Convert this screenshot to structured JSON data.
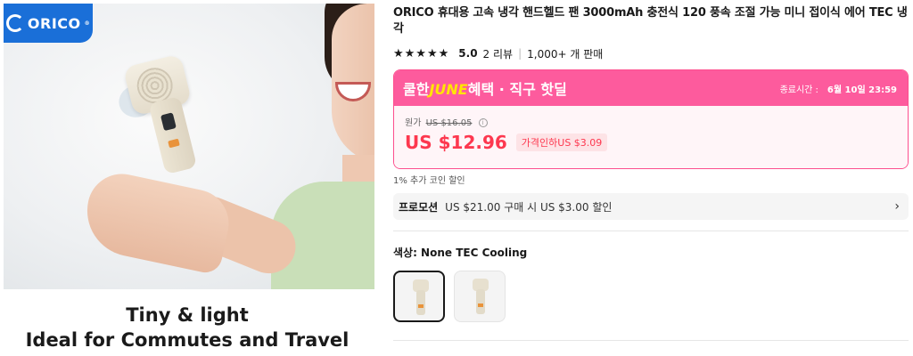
{
  "hero": {
    "brand_logo_text": "ORICO",
    "tagline_line1": "Tiny & light",
    "tagline_line2": "Ideal for Commutes and Travel"
  },
  "product": {
    "title": "ORICO 휴대용 고속 냉각 핸드헬드 팬 3000mAh 충전식 120 풍속 조절 가능 미니 접이식 에어 TEC 냉각",
    "rating_stars": "★★★★★",
    "rating_score": "5.0",
    "reviews": "2 리뷰",
    "sales": "1,000+ 개 판매"
  },
  "deal": {
    "name_prefix": "쿨한",
    "name_highlight": "JUNE",
    "name_suffix": "혜택 · 직구 핫딜",
    "end_label": "종료시간 :",
    "end_time": "6월 10일 23:59",
    "original_label": "원가",
    "original_price": "US $16.05",
    "price": "US $12.96",
    "discount": "가격인하US $3.09"
  },
  "coin_note": "1% 추가 코인 할인",
  "promotion": {
    "label": "프로모션",
    "text": "US $21.00 구매 시 US $3.00 할인"
  },
  "variant": {
    "label": "색상: None TEC Cooling"
  },
  "colors": {
    "accent_pink": "#fd5b9d",
    "price_red": "#fd384f",
    "brand_blue": "#1a6fd8"
  }
}
